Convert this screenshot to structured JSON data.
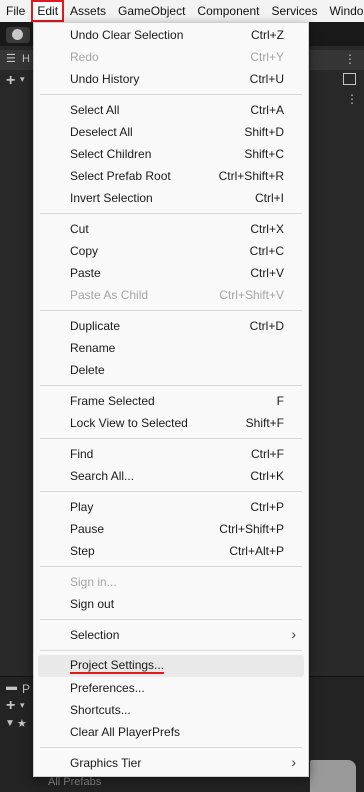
{
  "menubar": {
    "items": [
      "File",
      "Edit",
      "Assets",
      "GameObject",
      "Component",
      "Services",
      "Windo"
    ],
    "active_index": 1,
    "highlight_color": "#e0191e"
  },
  "background": {
    "left_tab_label": "H",
    "bottom_tab_label": "P",
    "bottom_hint": "All Prefabs"
  },
  "edit_menu": {
    "undo_clear_selection": {
      "label": "Undo Clear Selection",
      "shortcut": "Ctrl+Z"
    },
    "redo": {
      "label": "Redo",
      "shortcut": "Ctrl+Y"
    },
    "undo_history": {
      "label": "Undo History",
      "shortcut": "Ctrl+U"
    },
    "select_all": {
      "label": "Select All",
      "shortcut": "Ctrl+A"
    },
    "deselect_all": {
      "label": "Deselect All",
      "shortcut": "Shift+D"
    },
    "select_children": {
      "label": "Select Children",
      "shortcut": "Shift+C"
    },
    "select_prefab_root": {
      "label": "Select Prefab Root",
      "shortcut": "Ctrl+Shift+R"
    },
    "invert_selection": {
      "label": "Invert Selection",
      "shortcut": "Ctrl+I"
    },
    "cut": {
      "label": "Cut",
      "shortcut": "Ctrl+X"
    },
    "copy": {
      "label": "Copy",
      "shortcut": "Ctrl+C"
    },
    "paste": {
      "label": "Paste",
      "shortcut": "Ctrl+V"
    },
    "paste_as_child": {
      "label": "Paste As Child",
      "shortcut": "Ctrl+Shift+V"
    },
    "duplicate": {
      "label": "Duplicate",
      "shortcut": "Ctrl+D"
    },
    "rename": {
      "label": "Rename"
    },
    "delete": {
      "label": "Delete"
    },
    "frame_selected": {
      "label": "Frame Selected",
      "shortcut": "F"
    },
    "lock_view": {
      "label": "Lock View to Selected",
      "shortcut": "Shift+F"
    },
    "find": {
      "label": "Find",
      "shortcut": "Ctrl+F"
    },
    "search_all": {
      "label": "Search All...",
      "shortcut": "Ctrl+K"
    },
    "play": {
      "label": "Play",
      "shortcut": "Ctrl+P"
    },
    "pause": {
      "label": "Pause",
      "shortcut": "Ctrl+Shift+P"
    },
    "step": {
      "label": "Step",
      "shortcut": "Ctrl+Alt+P"
    },
    "sign_in": {
      "label": "Sign in..."
    },
    "sign_out": {
      "label": "Sign out"
    },
    "selection": {
      "label": "Selection"
    },
    "project_settings": {
      "label": "Project Settings..."
    },
    "preferences": {
      "label": "Preferences..."
    },
    "shortcuts": {
      "label": "Shortcuts..."
    },
    "clear_playerprefs": {
      "label": "Clear All PlayerPrefs"
    },
    "graphics_tier": {
      "label": "Graphics Tier"
    }
  }
}
